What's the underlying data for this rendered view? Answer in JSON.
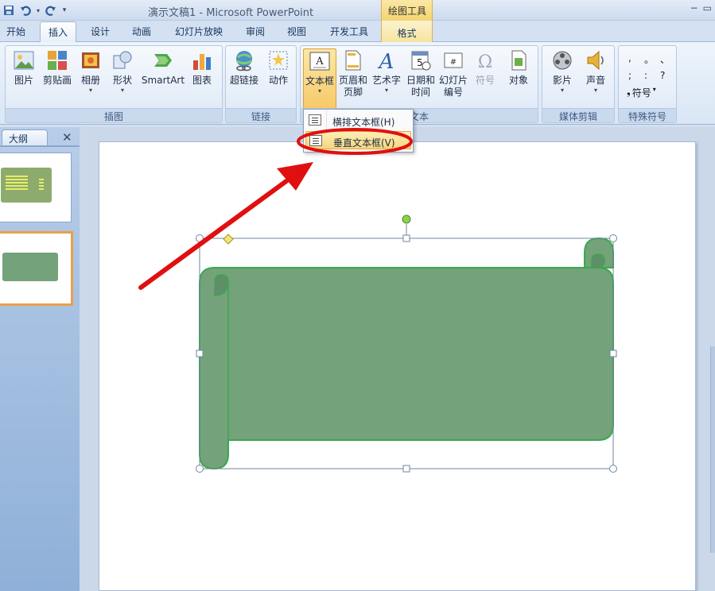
{
  "window": {
    "title": "演示文稿1 - Microsoft PowerPoint",
    "contextual_tab_group": "绘图工具",
    "controls": [
      "−",
      "▭"
    ]
  },
  "quick_access": [
    "save-icon",
    "undo-icon",
    "redo-icon",
    "customize-icon"
  ],
  "tabs": [
    {
      "label": "开始"
    },
    {
      "label": "插入"
    },
    {
      "label": "设计"
    },
    {
      "label": "动画"
    },
    {
      "label": "幻灯片放映"
    },
    {
      "label": "审阅"
    },
    {
      "label": "视图"
    },
    {
      "label": "开发工具"
    },
    {
      "label": "格式"
    }
  ],
  "active_tab": "插入",
  "ribbon": {
    "groups": {
      "illustrations": {
        "label": "插图",
        "buttons": [
          "图片",
          "剪贴画",
          "相册",
          "形状",
          "SmartArt",
          "图表"
        ]
      },
      "links": {
        "label": "链接",
        "buttons": [
          "超链接",
          "动作"
        ]
      },
      "text": {
        "label": "文本",
        "buttons": [
          "文本框",
          "页眉和",
          "页脚",
          "艺术字",
          "日期和",
          "时间",
          "幻灯片",
          "编号",
          "符号",
          "对象"
        ]
      },
      "media": {
        "label": "媒体剪辑",
        "buttons": [
          "影片",
          "声音"
        ]
      },
      "special": {
        "label": "特殊符号",
        "button": "符号",
        "symbols": [
          ",",
          "。",
          "、",
          ";",
          ":",
          "?"
        ]
      }
    }
  },
  "left_pane": {
    "tab": "大纲",
    "close": "✕"
  },
  "dropdown": {
    "items": [
      "横排文本框(H)",
      "垂直文本框(V)"
    ],
    "highlighted": "垂直文本框(V)"
  },
  "colors": {
    "scroll_fill": "#74a27a",
    "scroll_stroke": "#3aa84f",
    "arrow": "#e01010",
    "highlight_ellipse": "#e01010",
    "rotation_handle": "#8bd14c"
  }
}
